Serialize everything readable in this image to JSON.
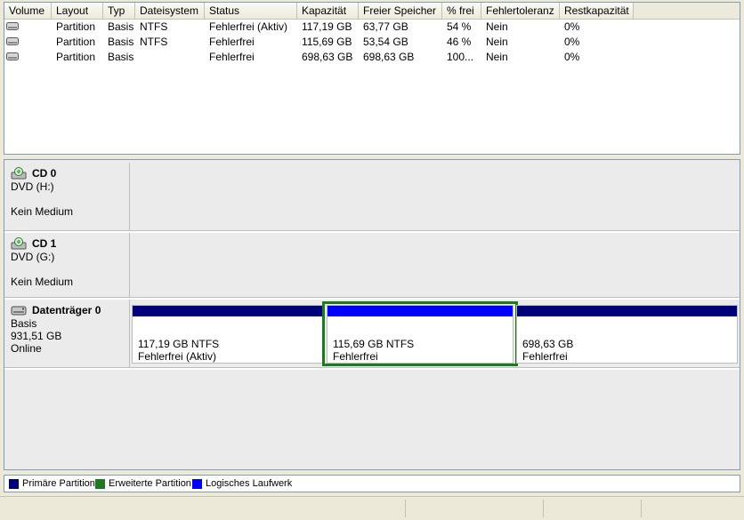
{
  "columns": [
    "Volume",
    "Layout",
    "Typ",
    "Dateisystem",
    "Status",
    "Kapazität",
    "Freier Speicher",
    "% frei",
    "Fehlertoleranz",
    "Restkapazität"
  ],
  "rows": [
    [
      "",
      "Partition",
      "Basis",
      "NTFS",
      "Fehlerfrei (Aktiv)",
      "117,19 GB",
      "63,77 GB",
      "54 %",
      "Nein",
      "0%"
    ],
    [
      "",
      "Partition",
      "Basis",
      "NTFS",
      "Fehlerfrei",
      "115,69 GB",
      "53,54 GB",
      "46 %",
      "Nein",
      "0%"
    ],
    [
      "",
      "Partition",
      "Basis",
      "",
      "Fehlerfrei",
      "698,63 GB",
      "698,63 GB",
      "100...",
      "Nein",
      "0%"
    ]
  ],
  "disks": {
    "cd0": {
      "name": "CD 0",
      "type": "DVD (H:)",
      "status": "Kein Medium"
    },
    "cd1": {
      "name": "CD 1",
      "type": "DVD (G:)",
      "status": "Kein Medium"
    },
    "disk0": {
      "name": "Datenträger 0",
      "type": "Basis",
      "size": "931,51 GB",
      "state": "Online",
      "partitions": [
        {
          "line1": "117,19 GB NTFS",
          "line2": "Fehlerfrei (Aktiv)"
        },
        {
          "line1": "115,69 GB NTFS",
          "line2": "Fehlerfrei"
        },
        {
          "line1": "698,63 GB",
          "line2": "Fehlerfrei"
        }
      ]
    }
  },
  "legend": {
    "primary": "Primäre Partition",
    "extended": "Erweiterte Partition",
    "logical": "Logisches Laufwerk"
  },
  "colors": {
    "primary": "#00007b",
    "extended": "#1e7a1e",
    "logical": "#0000ff"
  }
}
